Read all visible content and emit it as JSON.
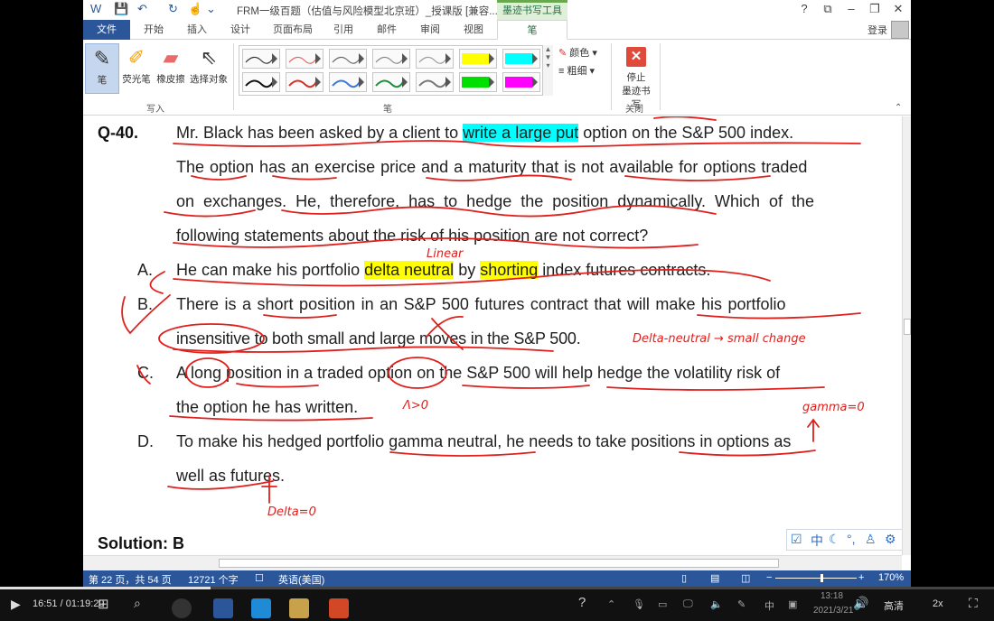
{
  "window": {
    "title": "FRM一级百题（估值与风险模型北京班）_授课版 [兼容...",
    "context_tab": "墨迹书写工具",
    "help": "?",
    "login": "登录"
  },
  "tabs": [
    "文件",
    "开始",
    "插入",
    "设计",
    "页面布局",
    "引用",
    "邮件",
    "审阅",
    "视图",
    "笔"
  ],
  "ribbon": {
    "tools": [
      "笔",
      "荧光笔",
      "橡皮擦",
      "选择对象"
    ],
    "group_write": "写入",
    "group_pens": "笔",
    "color_label": "颜色",
    "weight_label": "粗细",
    "stop_label_1": "停止",
    "stop_label_2": "墨迹书写",
    "group_close": "关闭"
  },
  "document": {
    "question_no": "Q-40.",
    "lines": [
      "Mr. Black has been asked by a client to ",
      "write a large put",
      " option on the S&P 500 index.",
      "The option has an exercise price and a maturity that is not available for options traded",
      "on exchanges. He, therefore, has to hedge the position dynamically. Which of the",
      "following statements about the risk of his position are not correct?"
    ],
    "options": {
      "A": {
        "label": "A.",
        "pre": "He can make his portfolio ",
        "hl1": "delta neutral",
        "mid": " by ",
        "hl2": "shorting",
        "post": " index futures contracts."
      },
      "B": {
        "label": "B.",
        "l1": "There is a short position in an S&P 500 futures contract that will make his portfolio",
        "l2": "insensitive to both small and large moves in the S&P 500."
      },
      "C": {
        "label": "C.",
        "l1": "A long position in a traded option on the S&P 500 will help hedge the volatility risk of",
        "l2": "the option he has written."
      },
      "D": {
        "label": "D.",
        "l1": "To make his hedged portfolio gamma neutral, he needs to take positions in options as",
        "l2": "well as futures."
      }
    },
    "solution": "Solution: B",
    "annotations": {
      "linear": "Linear",
      "delta_neutral": "Delta-neutral → small change",
      "lambda": "Λ>0",
      "gamma": "gamma=0",
      "delta": "Delta=0"
    }
  },
  "status": {
    "page": "第 22 页，共 54 页",
    "words": "12721 个字",
    "lang": "英语(美国)",
    "zoom": "170%"
  },
  "video": {
    "time": "16:51 / 01:19:20",
    "progress": 0.212,
    "clock": "13:18",
    "date": "2021/3/21",
    "quality": "高清",
    "speed": "2x"
  }
}
